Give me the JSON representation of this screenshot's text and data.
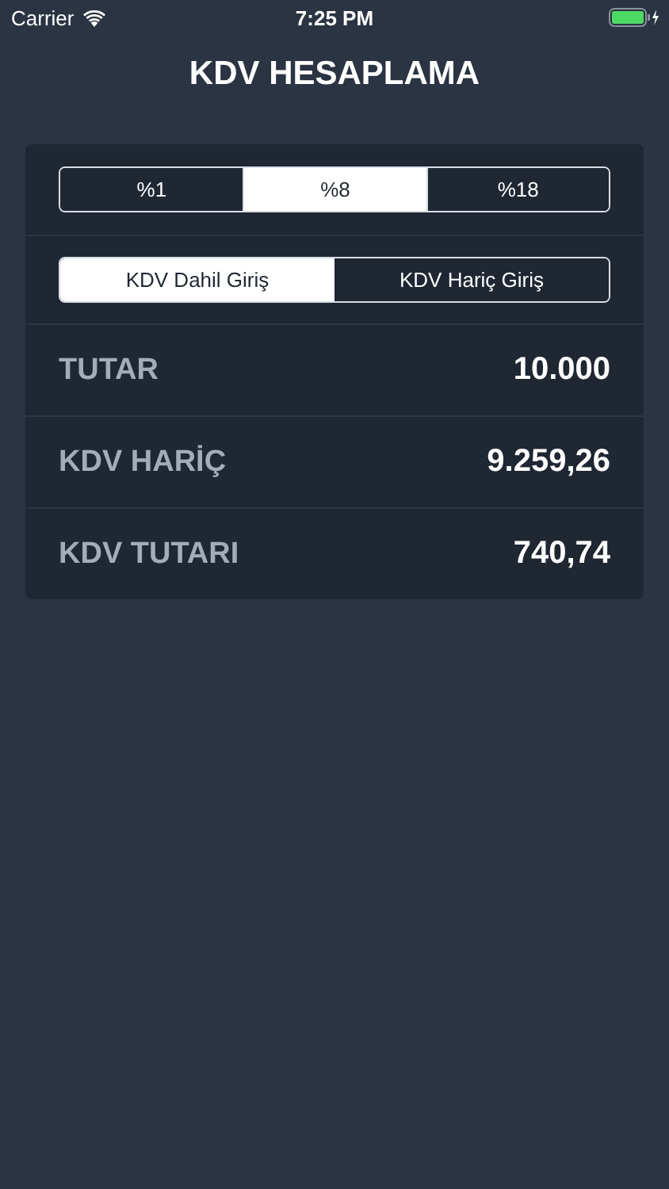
{
  "status_bar": {
    "carrier": "Carrier",
    "time": "7:25 PM"
  },
  "title": "KDV HESAPLAMA",
  "rates": [
    {
      "label": "%1",
      "selected": false
    },
    {
      "label": "%8",
      "selected": true
    },
    {
      "label": "%18",
      "selected": false
    }
  ],
  "modes": [
    {
      "label": "KDV Dahil Giriş",
      "selected": true
    },
    {
      "label": "KDV Hariç Giriş",
      "selected": false
    }
  ],
  "rows": [
    {
      "label": "TUTAR",
      "value": "10.000"
    },
    {
      "label": "KDV HARİÇ",
      "value": "9.259,26"
    },
    {
      "label": "KDV TUTARI",
      "value": "740,74"
    }
  ]
}
